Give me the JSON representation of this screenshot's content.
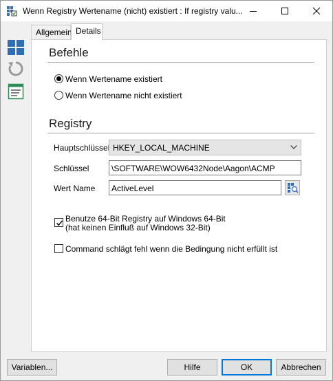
{
  "window": {
    "title": "Wenn Registry Wertename (nicht) existiert : If registry valu...",
    "controls": [
      "minimize",
      "maximize",
      "close"
    ]
  },
  "toolstrip": {
    "items": [
      {
        "icon": "windows-tiles-icon"
      },
      {
        "icon": "refresh-icon"
      },
      {
        "icon": "form-list-icon"
      }
    ]
  },
  "tabs": [
    {
      "label": "Allgemein",
      "selected": false
    },
    {
      "label": "Details",
      "selected": true
    }
  ],
  "befehle": {
    "title": "Befehle",
    "options": [
      {
        "label": "Wenn Wertename existiert",
        "checked": true
      },
      {
        "label": "Wenn Wertename nicht existiert",
        "checked": false
      }
    ]
  },
  "registry": {
    "title": "Registry",
    "hauptschluessel_label": "Hauptschlüssel",
    "hauptschluessel_value": "HKEY_LOCAL_MACHINE",
    "schluessel_label": "Schlüssel",
    "schluessel_value": "\\SOFTWARE\\WOW6432Node\\Aagon\\ACMP",
    "wertname_label": "Wert Name",
    "wertname_value": "ActiveLevel"
  },
  "checks": {
    "bit64_line1": "Benutze 64-Bit Registry auf Windows 64-Bit",
    "bit64_line2": "(hat keinen Einfluß auf Windows 32-Bit)",
    "bit64_checked": true,
    "fail_label": "Command schlägt fehl wenn die Bedingung nicht erfüllt ist",
    "fail_checked": false
  },
  "footer": {
    "variables": "Variablen...",
    "help": "Hilfe",
    "ok": "OK",
    "cancel": "Abbrechen"
  },
  "colors": {
    "accent": "#0078d7",
    "tile_blue": "#2b6cb0"
  }
}
